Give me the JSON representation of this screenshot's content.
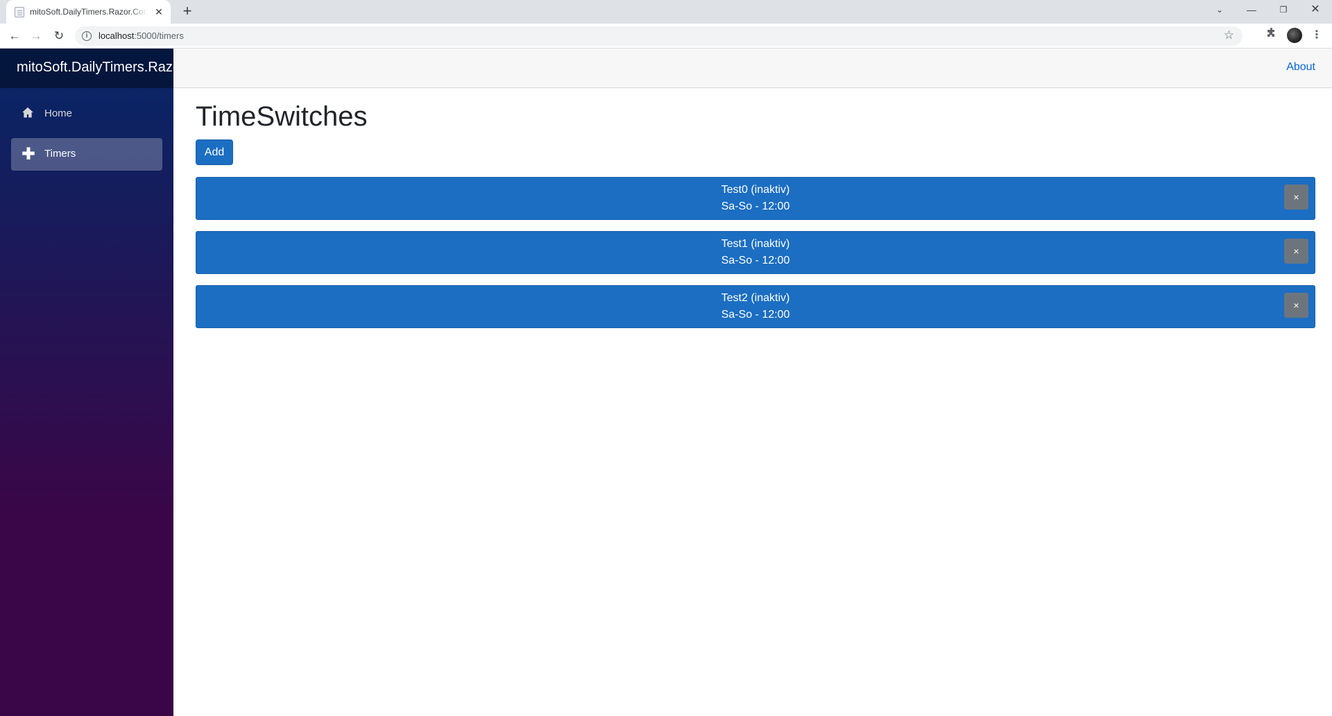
{
  "browser": {
    "tab_title": "mitoSoft.DailyTimers.Razor.Components",
    "url_host": "localhost",
    "url_path": ":5000/timers",
    "tab_close_glyph": "✕",
    "new_tab_glyph": "+",
    "icons": {
      "back": "arrow-left-icon",
      "forward": "arrow-right-icon",
      "reload": "reload-icon",
      "info": "info-icon",
      "star": "star-icon",
      "extensions": "puzzle-icon",
      "menu": "kebab-menu-icon"
    }
  },
  "app": {
    "brand": "mitoSoft.DailyTimers.Razor.Components",
    "about_label": "About",
    "sidebar": {
      "items": [
        {
          "label": "Home",
          "icon": "home-icon",
          "active": false
        },
        {
          "label": "Timers",
          "icon": "plus-icon",
          "active": true
        }
      ]
    },
    "page_title": "TimeSwitches",
    "add_label": "Add",
    "delete_glyph": "×",
    "timers": [
      {
        "name": "Test0 (inaktiv)",
        "schedule": "Sa-So - 12:00"
      },
      {
        "name": "Test1 (inaktiv)",
        "schedule": "Sa-So - 12:00"
      },
      {
        "name": "Test2 (inaktiv)",
        "schedule": "Sa-So - 12:00"
      }
    ]
  },
  "colors": {
    "primary": "#1b6ec2",
    "primary_border": "#1861ac",
    "secondary": "#6c757d",
    "link": "#0366d6",
    "sidebar_top": "#052767",
    "sidebar_bottom": "#3a0647"
  }
}
